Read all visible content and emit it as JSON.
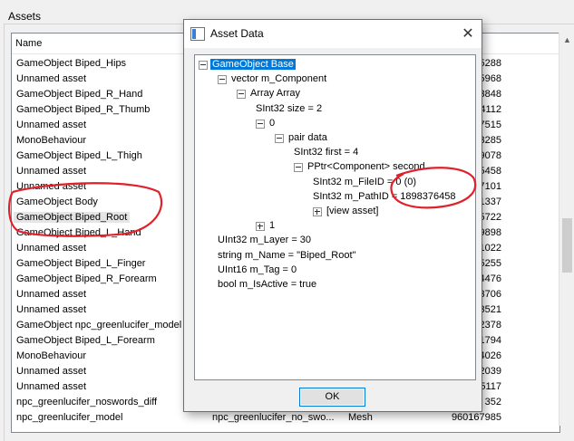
{
  "panel": {
    "title": "Assets"
  },
  "list": {
    "columns": {
      "name": "Name"
    },
    "rows": [
      {
        "name": "GameObject Biped_Hips",
        "pathid": "5288"
      },
      {
        "name": "Unnamed asset",
        "pathid": "5968"
      },
      {
        "name": "GameObject Biped_R_Hand",
        "pathid": "3848"
      },
      {
        "name": "GameObject Biped_R_Thumb",
        "pathid": "4112"
      },
      {
        "name": "Unnamed asset",
        "pathid": "7515"
      },
      {
        "name": "MonoBehaviour",
        "pathid": "3285"
      },
      {
        "name": "GameObject Biped_L_Thigh",
        "pathid": "9078"
      },
      {
        "name": "Unnamed asset",
        "pathid": "5458"
      },
      {
        "name": "Unnamed asset",
        "pathid": "7101"
      },
      {
        "name": "GameObject Body",
        "pathid": "1337"
      },
      {
        "name": "GameObject Biped_Root",
        "pathid": "5722",
        "selected": true
      },
      {
        "name": "GameObject Biped_L_Hand",
        "pathid": "9898"
      },
      {
        "name": "Unnamed asset",
        "pathid": "1022"
      },
      {
        "name": "GameObject Biped_L_Finger",
        "pathid": "5255"
      },
      {
        "name": "GameObject Biped_R_Forearm",
        "pathid": "4476"
      },
      {
        "name": "Unnamed asset",
        "pathid": "3706"
      },
      {
        "name": "Unnamed asset",
        "pathid": "3521"
      },
      {
        "name": "GameObject npc_greenlucifer_model",
        "pathid": "2378"
      },
      {
        "name": "GameObject Biped_L_Forearm",
        "pathid": "1794"
      },
      {
        "name": "MonoBehaviour",
        "pathid": "4026"
      },
      {
        "name": "Unnamed asset",
        "pathid": "2039"
      },
      {
        "name": "Unnamed asset",
        "pathid": "5117"
      },
      {
        "name": "npc_greenlucifer_noswords_diff",
        "pathid": "352"
      },
      {
        "name": "npc_greenlucifer_model",
        "container": "npc_greenlucifer_no_swo...",
        "type": "Mesh",
        "pathid": "960167985"
      }
    ]
  },
  "dialog": {
    "title": "Asset Data",
    "close_glyph": "✕",
    "ok_label": "OK",
    "tree": [
      {
        "text": "GameObject Base",
        "depth": 0,
        "expander": "minus",
        "selected": true
      },
      {
        "text": "vector m_Component",
        "depth": 1,
        "expander": "minus"
      },
      {
        "text": "Array Array",
        "depth": 2,
        "expander": "minus"
      },
      {
        "text": "SInt32 size = 2",
        "depth": 3,
        "expander": "none"
      },
      {
        "text": "0",
        "depth": 3,
        "expander": "minus"
      },
      {
        "text": "pair data",
        "depth": 4,
        "expander": "minus"
      },
      {
        "text": "SInt32 first = 4",
        "depth": 5,
        "expander": "none"
      },
      {
        "text": "PPtr<Component> second",
        "depth": 5,
        "expander": "minus"
      },
      {
        "text": "SInt32 m_FileID = 0 (0)",
        "depth": 6,
        "expander": "none"
      },
      {
        "text": "SInt32 m_PathID = 1898376458",
        "depth": 6,
        "expander": "none"
      },
      {
        "text": "[view asset]",
        "depth": 6,
        "expander": "plus"
      },
      {
        "text": "1",
        "depth": 3,
        "expander": "plus"
      },
      {
        "text": "UInt32 m_Layer = 30",
        "depth": 1,
        "expander": "none"
      },
      {
        "text": "string m_Name = \"Biped_Root\"",
        "depth": 1,
        "expander": "none"
      },
      {
        "text": "UInt16 m_Tag = 0",
        "depth": 1,
        "expander": "none"
      },
      {
        "text": "bool m_IsActive = true",
        "depth": 1,
        "expander": "none"
      }
    ]
  },
  "annotation_color": "#e0202a"
}
